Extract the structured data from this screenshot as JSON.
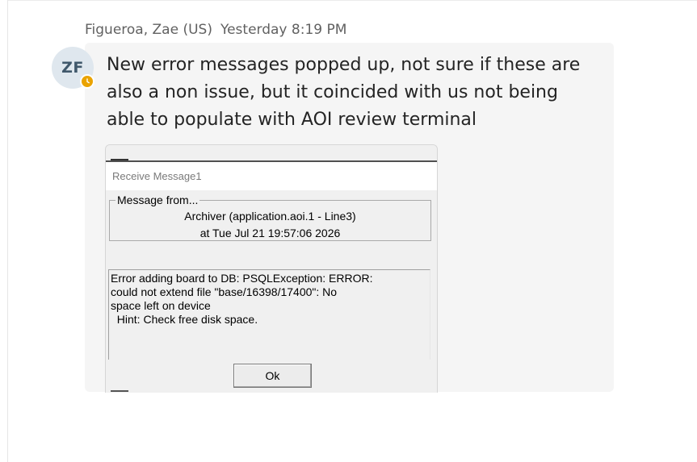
{
  "message": {
    "author": "Figueroa, Zae (US)",
    "timestamp": "Yesterday 8:19 PM",
    "avatar_initials": "ZF",
    "presence_status": "away",
    "presence_color": "#eaa300",
    "text": "New error messages popped up, not sure if these are also a non issue, but it coincided with us not being able to populate with AOI review terminal"
  },
  "attachment": {
    "window_title": "Receive Message1",
    "group_label": "Message from...",
    "from_line1": "Archiver (application.aoi.1 - Line3)",
    "from_line2": "at Tue Jul 21 19:57:06 2026",
    "error_text": "Error adding board to DB: PSQLException: ERROR:\ncould not extend file \"base/16398/17400\": No\nspace left on device\n  Hint: Check free disk space.",
    "ok_label": "Ok"
  }
}
